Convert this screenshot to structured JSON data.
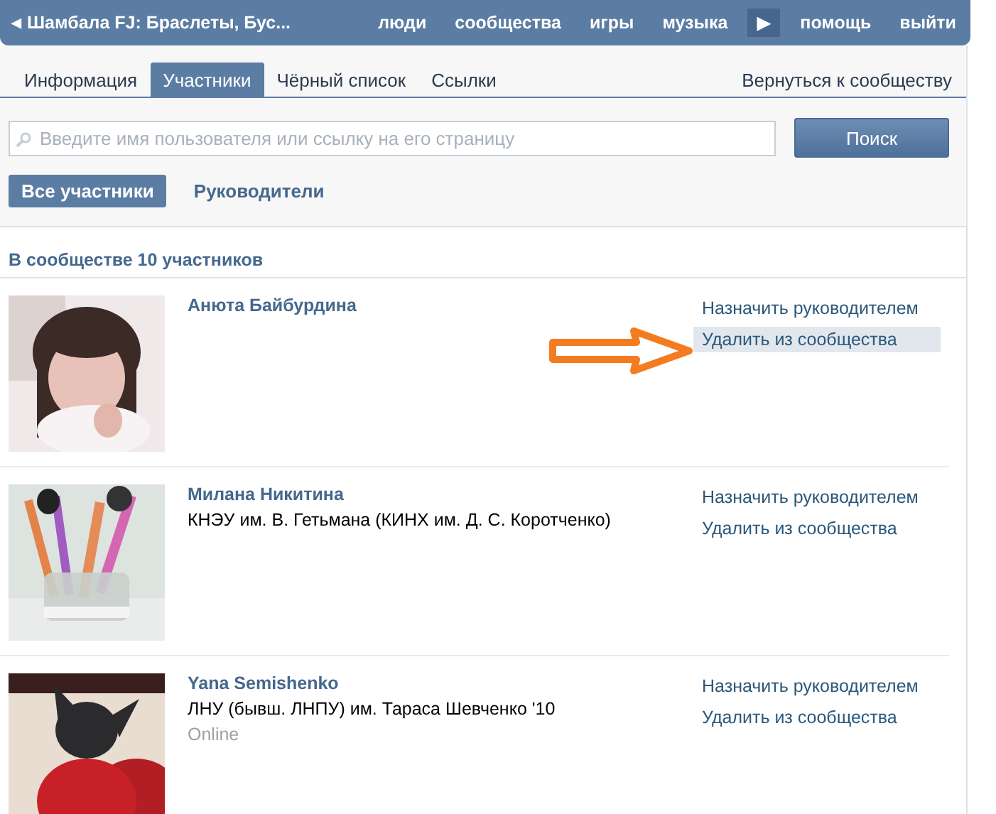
{
  "top_bar": {
    "back_arrow": "◀",
    "group_title": "Шамбала FJ: Браслеты, Бус...",
    "nav": [
      "люди",
      "сообщества",
      "игры",
      "музыка"
    ],
    "more_arrow": "▶",
    "nav_right": [
      "помощь",
      "выйти"
    ]
  },
  "tabs": [
    {
      "label": "Информация",
      "selected": false
    },
    {
      "label": "Участники",
      "selected": true
    },
    {
      "label": "Чёрный список",
      "selected": false
    },
    {
      "label": "Ссылки",
      "selected": false
    }
  ],
  "back_link": "Вернуться к сообществу",
  "search": {
    "placeholder": "Введите имя пользователя или ссылку на его страницу",
    "button": "Поиск"
  },
  "filters": [
    {
      "label": "Все участники",
      "selected": true
    },
    {
      "label": "Руководители",
      "selected": false
    }
  ],
  "count_heading": "В сообществе 10 участников",
  "members": [
    {
      "photo": {
        "kind": "picture"
      },
      "name": "Анюта Байбурдина",
      "actions": [
        {
          "label": "Назначить руководителем",
          "highlighted": false
        },
        {
          "label": "Удалить из сообщества",
          "highlighted": true
        }
      ],
      "arrow_annotation": true
    },
    {
      "photo": {
        "kind": "picture"
      },
      "name": "Милана Никитина",
      "education": "КНЭУ им. В. Гетьмана (КИНХ им. Д. С. Коротченко)",
      "actions": [
        {
          "label": "Назначить руководителем",
          "highlighted": false
        },
        {
          "label": "Удалить из сообщества",
          "highlighted": false
        }
      ],
      "arrow_annotation": false
    },
    {
      "photo": {
        "kind": "picture"
      },
      "name": "Yana Semishenko",
      "education": "ЛНУ (бывш. ЛНПУ) им. Тараса Шевченко '10",
      "status": "Online",
      "actions": [
        {
          "label": "Назначить руководителем",
          "highlighted": false
        },
        {
          "label": "Удалить из сообщества",
          "highlighted": false
        }
      ],
      "arrow_annotation": false
    }
  ]
}
